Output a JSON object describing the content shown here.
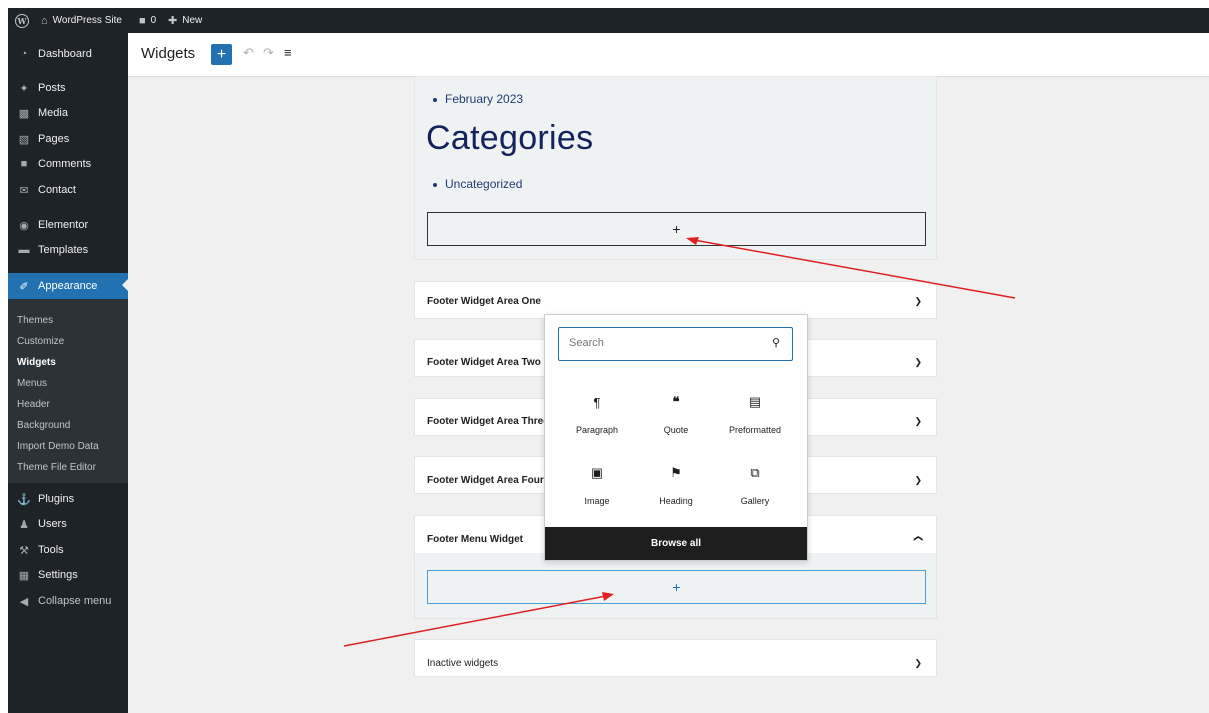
{
  "adminbar": {
    "site_name": "WordPress Site",
    "comments_count": "0",
    "new_label": "New"
  },
  "sidebar": {
    "items": [
      {
        "label": "Dashboard",
        "icon": "dashboard-icon"
      },
      {
        "label": "Posts",
        "icon": "pin-icon"
      },
      {
        "label": "Media",
        "icon": "media-icon"
      },
      {
        "label": "Pages",
        "icon": "pages-icon"
      },
      {
        "label": "Comments",
        "icon": "comment-icon"
      },
      {
        "label": "Contact",
        "icon": "mail-icon"
      },
      {
        "label": "Elementor",
        "icon": "elementor-icon"
      },
      {
        "label": "Templates",
        "icon": "folder-icon"
      },
      {
        "label": "Appearance",
        "icon": "brush-icon"
      },
      {
        "label": "Plugins",
        "icon": "plugin-icon"
      },
      {
        "label": "Users",
        "icon": "users-icon"
      },
      {
        "label": "Tools",
        "icon": "wrench-icon"
      },
      {
        "label": "Settings",
        "icon": "settings-icon"
      },
      {
        "label": "Collapse menu",
        "icon": "collapse-icon"
      }
    ],
    "submenu": [
      "Themes",
      "Customize",
      "Widgets",
      "Menus",
      "Header",
      "Background",
      "Import Demo Data",
      "Theme File Editor"
    ]
  },
  "toolbar": {
    "title": "Widgets"
  },
  "widgets": {
    "archive_item": "February 2023",
    "categories_heading": "Categories",
    "category_item": "Uncategorized",
    "appender_label": "+",
    "areas": [
      "Footer Widget Area One",
      "Footer Widget Area Two",
      "Footer Widget Area Three",
      "Footer Widget Area Four",
      "Footer Menu Widget",
      "Inactive widgets"
    ]
  },
  "inserter": {
    "search_placeholder": "Search",
    "blocks": [
      {
        "label": "Paragraph",
        "icon": "paragraph-icon"
      },
      {
        "label": "Quote",
        "icon": "quote-icon"
      },
      {
        "label": "Preformatted",
        "icon": "preformatted-icon"
      },
      {
        "label": "Image",
        "icon": "image-icon"
      },
      {
        "label": "Heading",
        "icon": "heading-icon"
      },
      {
        "label": "Gallery",
        "icon": "gallery-icon"
      }
    ],
    "browse_all": "Browse all"
  },
  "colors": {
    "admin_dark": "#1d2327",
    "accent": "#2271b1",
    "annotation_arrow": "#e02020",
    "heading_navy": "#13225a"
  }
}
